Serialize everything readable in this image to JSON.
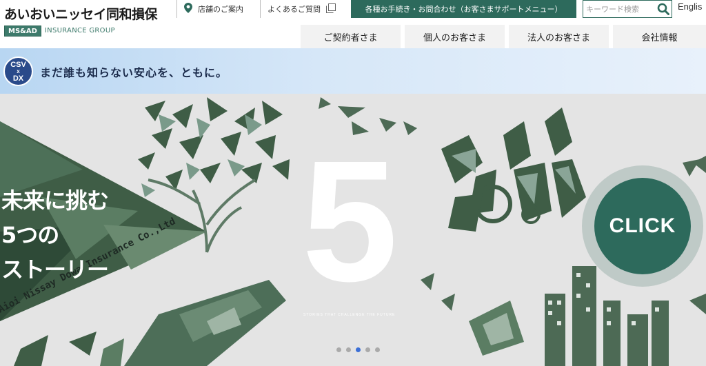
{
  "header": {
    "company_name": "あいおいニッセイ同和損保",
    "group_badge": "MS&AD",
    "group_text": "INSURANCE GROUP",
    "store_link": "店舗のご案内",
    "faq_link": "よくあるご質問",
    "support_button": "各種お手続き・お問合わせ（お客さまサポートメニュー）",
    "search_placeholder": "キーワード検索",
    "language_link": "Englis"
  },
  "nav": {
    "items": [
      "ご契約者さま",
      "個人のお客さま",
      "法人のお客さま",
      "会社情報"
    ]
  },
  "banner": {
    "badge_top": "CSV",
    "badge_mid": "x",
    "badge_bottom": "DX",
    "tagline": "まだ誰も知らない安心を、ともに。"
  },
  "hero": {
    "title_line1": "未来に挑む",
    "title_line2": "5つの",
    "title_line3": "ストーリー",
    "big_number": "5",
    "caption": "STORIES THAT CHALLENGE THE FUTURE",
    "side_text": "Aioi Nissay Dowa Insurance Co.,Ltd",
    "click_label": "CLICK",
    "slide_count": 5,
    "active_slide": 3
  },
  "colors": {
    "brand_green": "#2d6a5c",
    "banner_blue": "#b8d6f2",
    "active_dot": "#3b6fd6"
  }
}
